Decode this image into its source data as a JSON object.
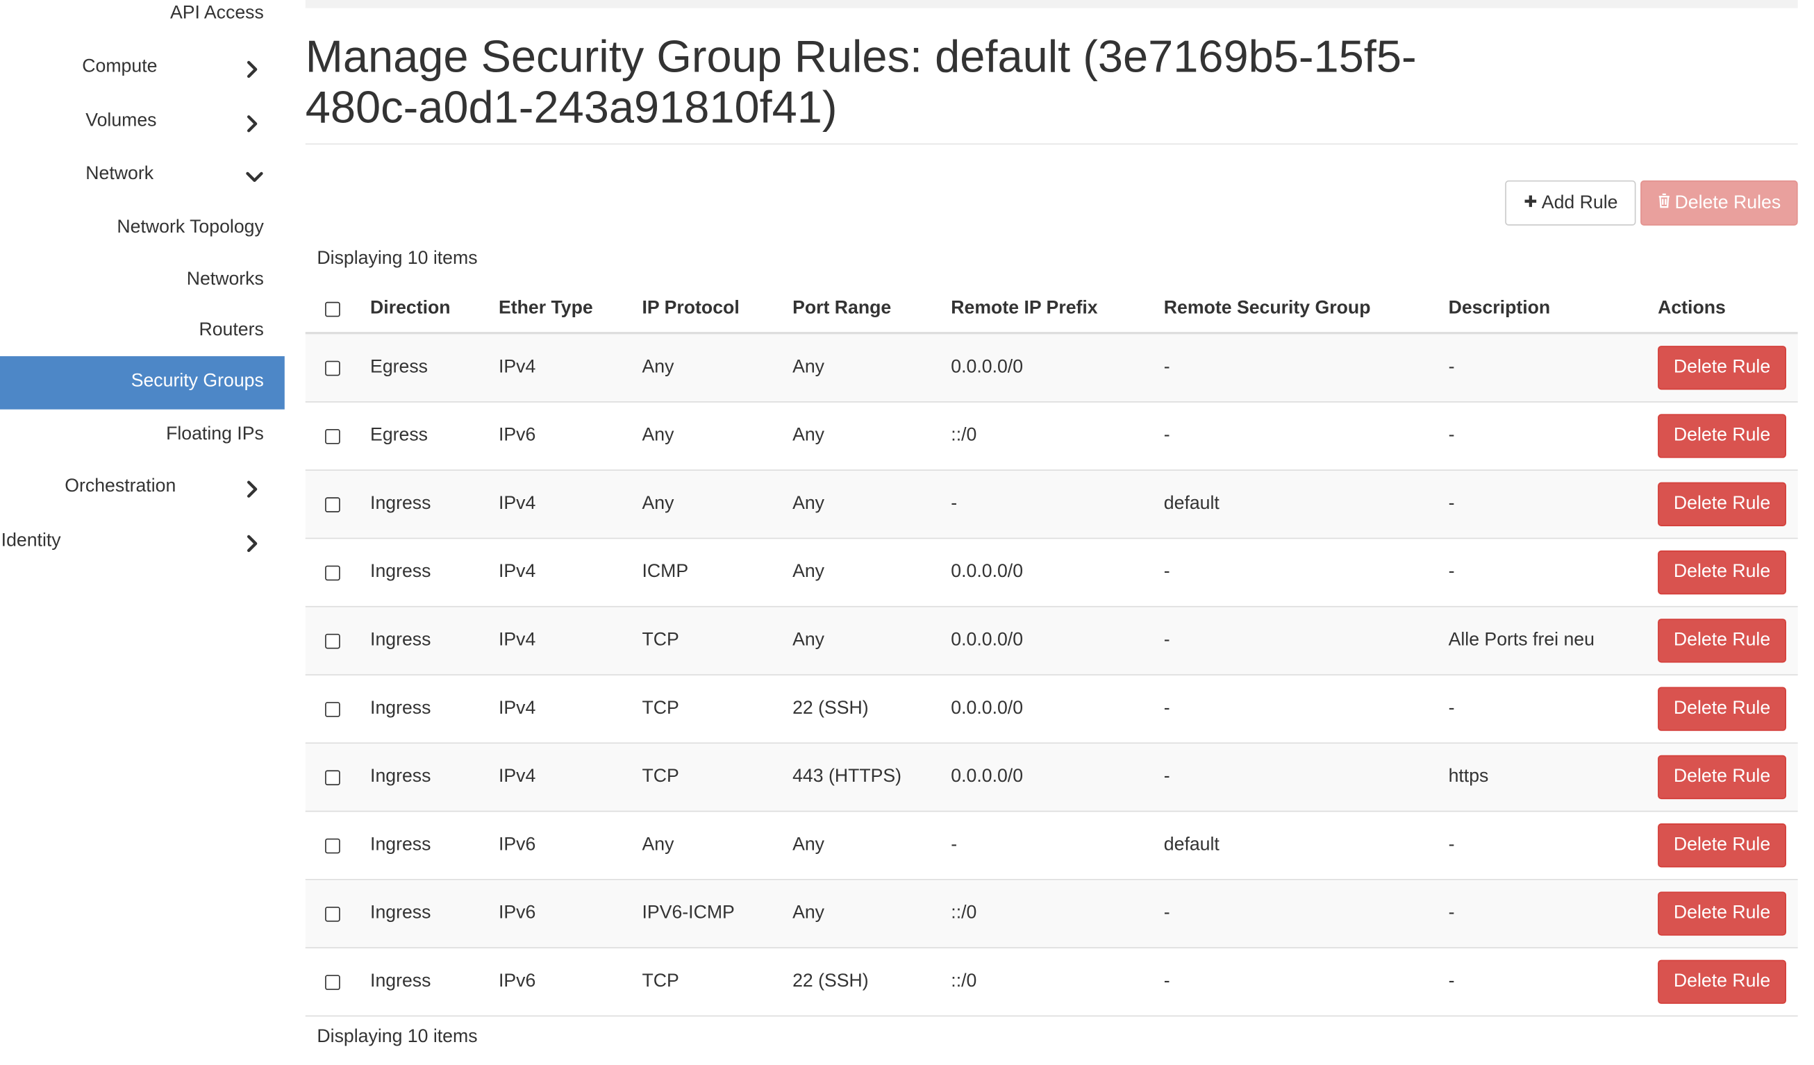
{
  "sidebar": {
    "items": [
      {
        "label": "API Access",
        "chevron": "none"
      },
      {
        "label": "Compute",
        "chevron": "right"
      },
      {
        "label": "Volumes",
        "chevron": "right"
      },
      {
        "label": "Network",
        "chevron": "down"
      },
      {
        "label": "Network Topology",
        "chevron": "none"
      },
      {
        "label": "Networks",
        "chevron": "none"
      },
      {
        "label": "Routers",
        "chevron": "none"
      },
      {
        "label": "Security Groups",
        "chevron": "none",
        "active": true
      },
      {
        "label": "Floating IPs",
        "chevron": "none"
      },
      {
        "label": "Orchestration",
        "chevron": "right"
      },
      {
        "label": "Identity",
        "chevron": "right"
      }
    ]
  },
  "page": {
    "title": "Manage Security Group Rules: default (3e7169b5-15f5-480c-a0d1-243a91810f41)",
    "add_rule_label": "Add Rule",
    "delete_rules_label": "Delete Rules",
    "count_top": "Displaying 10 items",
    "count_bottom": "Displaying 10 items"
  },
  "table": {
    "columns": [
      "Direction",
      "Ether Type",
      "IP Protocol",
      "Port Range",
      "Remote IP Prefix",
      "Remote Security Group",
      "Description",
      "Actions"
    ],
    "action_label": "Delete Rule",
    "rows": [
      {
        "direction": "Egress",
        "ether": "IPv4",
        "proto": "Any",
        "port": "Any",
        "rip": "0.0.0.0/0",
        "rsg": "-",
        "desc": "-"
      },
      {
        "direction": "Egress",
        "ether": "IPv6",
        "proto": "Any",
        "port": "Any",
        "rip": "::/0",
        "rsg": "-",
        "desc": "-"
      },
      {
        "direction": "Ingress",
        "ether": "IPv4",
        "proto": "Any",
        "port": "Any",
        "rip": "-",
        "rsg": "default",
        "desc": "-"
      },
      {
        "direction": "Ingress",
        "ether": "IPv4",
        "proto": "ICMP",
        "port": "Any",
        "rip": "0.0.0.0/0",
        "rsg": "-",
        "desc": "-"
      },
      {
        "direction": "Ingress",
        "ether": "IPv4",
        "proto": "TCP",
        "port": "Any",
        "rip": "0.0.0.0/0",
        "rsg": "-",
        "desc": "Alle Ports frei neu"
      },
      {
        "direction": "Ingress",
        "ether": "IPv4",
        "proto": "TCP",
        "port": "22 (SSH)",
        "rip": "0.0.0.0/0",
        "rsg": "-",
        "desc": "-"
      },
      {
        "direction": "Ingress",
        "ether": "IPv4",
        "proto": "TCP",
        "port": "443 (HTTPS)",
        "rip": "0.0.0.0/0",
        "rsg": "-",
        "desc": "https"
      },
      {
        "direction": "Ingress",
        "ether": "IPv6",
        "proto": "Any",
        "port": "Any",
        "rip": "-",
        "rsg": "default",
        "desc": "-"
      },
      {
        "direction": "Ingress",
        "ether": "IPv6",
        "proto": "IPV6-ICMP",
        "port": "Any",
        "rip": "::/0",
        "rsg": "-",
        "desc": "-"
      },
      {
        "direction": "Ingress",
        "ether": "IPv6",
        "proto": "TCP",
        "port": "22 (SSH)",
        "rip": "::/0",
        "rsg": "-",
        "desc": "-"
      }
    ]
  },
  "icons": {
    "chevron_right": "chevron-right-icon",
    "chevron_down": "chevron-down-icon",
    "plus": "plus-icon",
    "trash": "trash-icon"
  },
  "colors": {
    "active_sidebar": "#4d87c7",
    "danger": "#d9534f",
    "danger_disabled": "#e9a09d"
  }
}
